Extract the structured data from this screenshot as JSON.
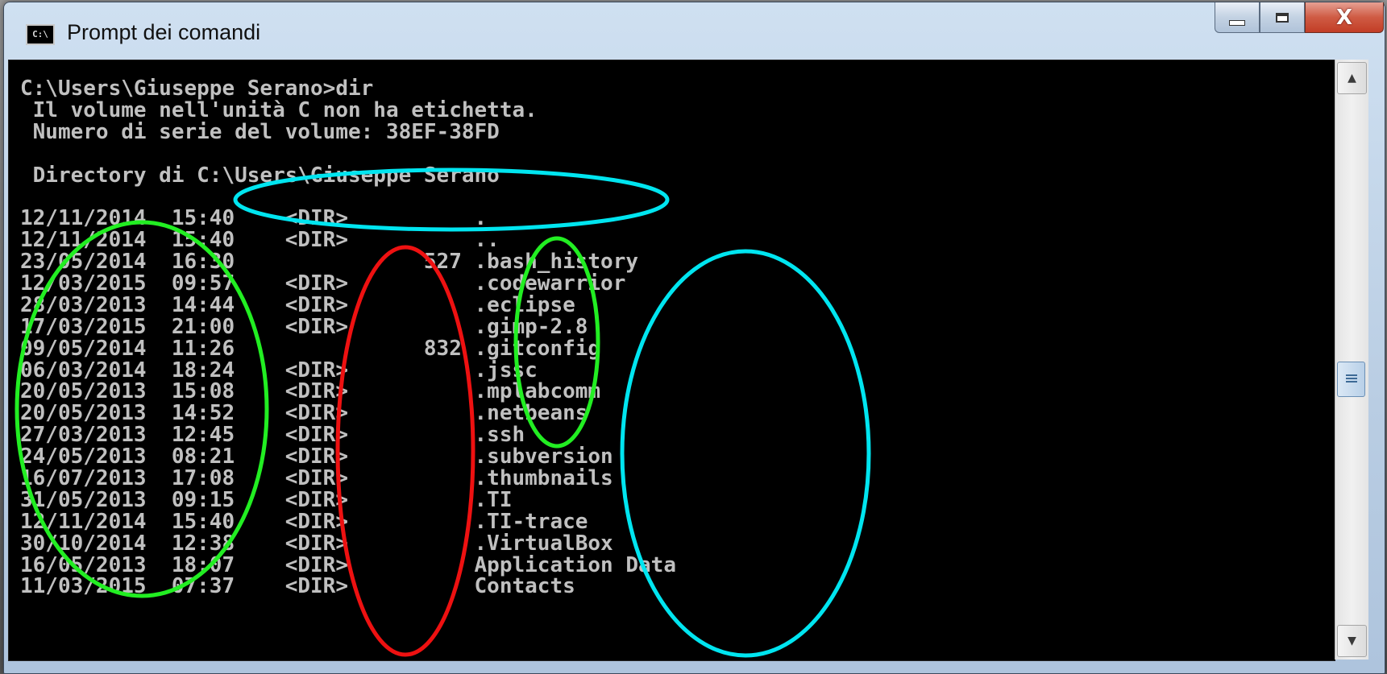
{
  "window": {
    "title": "Prompt dei comandi",
    "icon_label": "C:\\",
    "buttons": {
      "minimize": "minimize-icon",
      "maximize": "maximize-icon",
      "close": "close-icon"
    }
  },
  "console": {
    "lines": [
      "C:\\Users\\Giuseppe Serano>dir",
      " Il volume nell'unità C non ha etichetta.",
      " Numero di serie del volume: 38EF-38FD",
      "",
      " Directory di C:\\Users\\Giuseppe Serano",
      "",
      "12/11/2014  15:40    <DIR>          .",
      "12/11/2014  15:40    <DIR>          ..",
      "23/05/2014  16:30               527 .bash_history",
      "12/03/2015  09:57    <DIR>          .codewarrior",
      "28/03/2013  14:44    <DIR>          .eclipse",
      "17/03/2015  21:00    <DIR>          .gimp-2.8",
      "09/05/2014  11:26               832 .gitconfig",
      "06/03/2014  18:24    <DIR>          .jssc",
      "20/05/2013  15:08    <DIR>          .mplabcomm",
      "20/05/2013  14:52    <DIR>          .netbeans",
      "27/03/2013  12:45    <DIR>          .ssh",
      "24/05/2013  08:21    <DIR>          .subversion",
      "16/07/2013  17:08    <DIR>          .thumbnails",
      "31/05/2013  09:15    <DIR>          .TI",
      "12/11/2014  15:40    <DIR>          .TI-trace",
      "30/10/2014  12:38    <DIR>          .VirtualBox",
      "16/05/2013  18:07    <DIR>          Application Data",
      "11/03/2015  07:37    <DIR>          Contacts"
    ],
    "text_color": "#c0c0c0",
    "background": "#000000"
  },
  "annotations": {
    "colors": {
      "green": "#22ee22",
      "red": "#ee1111",
      "cyan": "#00e5f0"
    }
  },
  "scrollbar": {
    "up_icon": "arrow-up-icon",
    "down_icon": "arrow-down-icon",
    "thumb_icon": "grip-icon",
    "position": 0.42
  }
}
